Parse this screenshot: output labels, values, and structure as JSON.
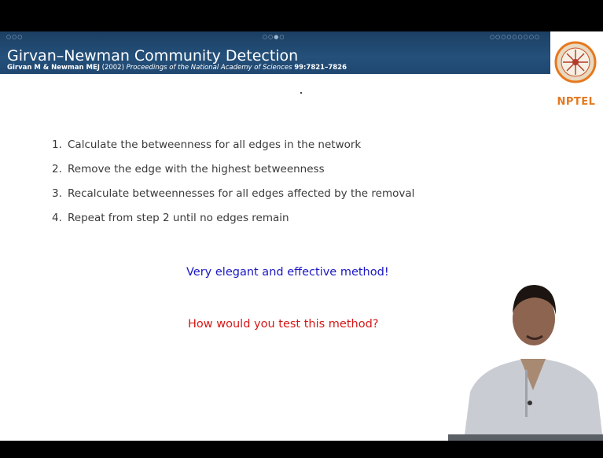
{
  "slide": {
    "nav_left": "○○○",
    "nav_mid": "○○●○",
    "nav_right": "○○○○○○○○○",
    "title": "Girvan–Newman Community Detection",
    "citation": {
      "authors": "Girvan M & Newman MEJ",
      "year": "(2002)",
      "journal": "Proceedings of the National Academy of Sciences",
      "pages": "99:7821–7826"
    },
    "logo_text": "NPTEL",
    "steps": [
      {
        "num": "1.",
        "text": "Calculate the betweenness for all edges in the network"
      },
      {
        "num": "2.",
        "text": "Remove the edge with the highest betweenness"
      },
      {
        "num": "3.",
        "text": "Recalculate betweennesses for all edges affected by the removal"
      },
      {
        "num": "4.",
        "text": "Repeat from step 2 until no edges remain"
      }
    ],
    "highlight": "Very elegant and effective method!",
    "question": "How would you test this method?"
  },
  "colors": {
    "header_band": "#24507a",
    "highlight_text": "#1a17c4",
    "question_text": "#d61717",
    "nptel_orange": "#e6781e"
  }
}
